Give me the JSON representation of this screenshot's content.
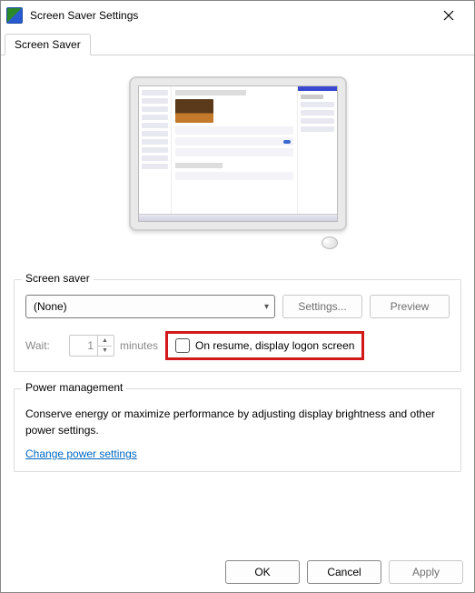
{
  "window": {
    "title": "Screen Saver Settings"
  },
  "tab": {
    "label": "Screen Saver"
  },
  "screensaver_group": {
    "label": "Screen saver",
    "selected": "(None)",
    "settings_btn": "Settings...",
    "preview_btn": "Preview",
    "wait_label": "Wait:",
    "wait_value": "1",
    "minutes_label": "minutes",
    "resume_label": "On resume, display logon screen"
  },
  "power_group": {
    "label": "Power management",
    "text": "Conserve energy or maximize performance by adjusting display brightness and other power settings.",
    "link": "Change power settings"
  },
  "footer": {
    "ok": "OK",
    "cancel": "Cancel",
    "apply": "Apply"
  }
}
